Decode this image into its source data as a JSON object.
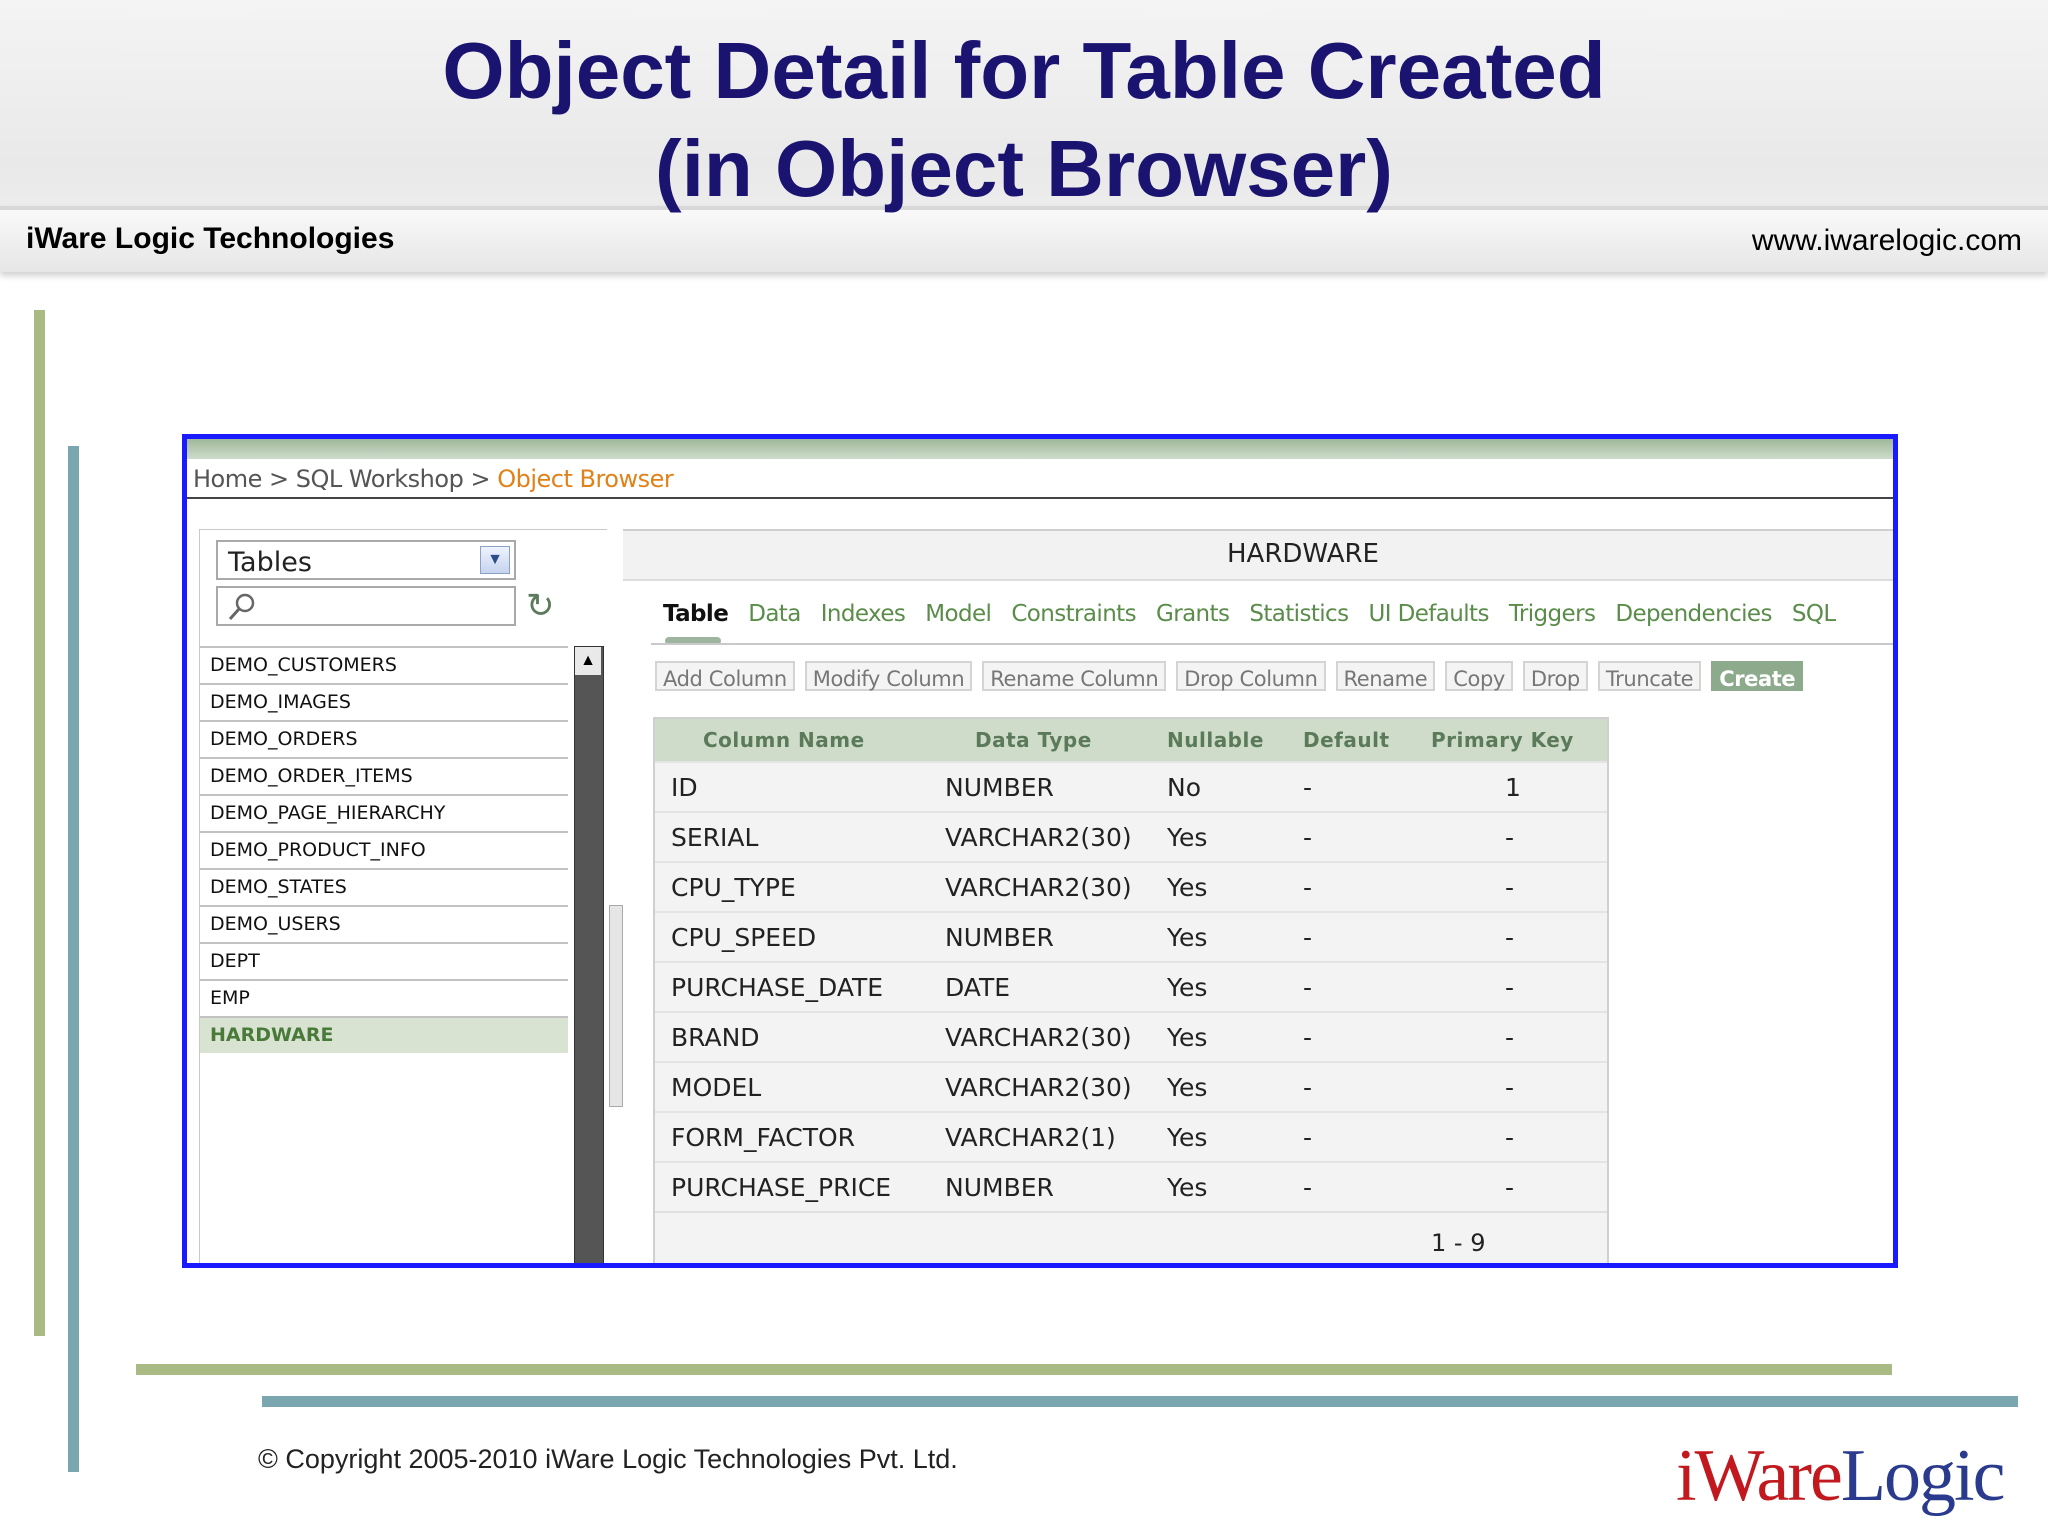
{
  "slide": {
    "title_line1": "Object Detail for Table Created",
    "title_line2": "(in Object Browser)",
    "company": "iWare Logic Technologies",
    "url": "www.iwarelogic.com",
    "copyright": "© Copyright 2005-2010 iWare Logic Technologies Pvt. Ltd.",
    "logo": {
      "part1": "iWare",
      "part2": "Logic"
    }
  },
  "breadcrumb": {
    "items": [
      "Home",
      "SQL Workshop"
    ],
    "separator": ">",
    "current": "Object Browser"
  },
  "object_list": {
    "type_select_value": "Tables",
    "search_value": "",
    "items": [
      "DEMO_CUSTOMERS",
      "DEMO_IMAGES",
      "DEMO_ORDERS",
      "DEMO_ORDER_ITEMS",
      "DEMO_PAGE_HIERARCHY",
      "DEMO_PRODUCT_INFO",
      "DEMO_STATES",
      "DEMO_USERS",
      "DEPT",
      "EMP",
      "HARDWARE"
    ],
    "selected": "HARDWARE"
  },
  "object_detail": {
    "title": "HARDWARE",
    "tabs": [
      "Table",
      "Data",
      "Indexes",
      "Model",
      "Constraints",
      "Grants",
      "Statistics",
      "UI Defaults",
      "Triggers",
      "Dependencies",
      "SQL"
    ],
    "active_tab": "Table",
    "actions": [
      "Add Column",
      "Modify Column",
      "Rename Column",
      "Drop Column",
      "Rename",
      "Copy",
      "Drop",
      "Truncate",
      "Create"
    ],
    "columns_header": [
      "Column Name",
      "Data Type",
      "Nullable",
      "Default",
      "Primary Key"
    ],
    "rows": [
      [
        "ID",
        "NUMBER",
        "No",
        "-",
        "1"
      ],
      [
        "SERIAL",
        "VARCHAR2(30)",
        "Yes",
        "-",
        "-"
      ],
      [
        "CPU_TYPE",
        "VARCHAR2(30)",
        "Yes",
        "-",
        "-"
      ],
      [
        "CPU_SPEED",
        "NUMBER",
        "Yes",
        "-",
        "-"
      ],
      [
        "PURCHASE_DATE",
        "DATE",
        "Yes",
        "-",
        "-"
      ],
      [
        "BRAND",
        "VARCHAR2(30)",
        "Yes",
        "-",
        "-"
      ],
      [
        "MODEL",
        "VARCHAR2(30)",
        "Yes",
        "-",
        "-"
      ],
      [
        "FORM_FACTOR",
        "VARCHAR2(1)",
        "Yes",
        "-",
        "-"
      ],
      [
        "PURCHASE_PRICE",
        "NUMBER",
        "Yes",
        "-",
        "-"
      ]
    ],
    "pagination": "1 - 9"
  },
  "colors": {
    "title": "#1a1470",
    "frame_border": "#1a1aff",
    "accent_green": "#a9bb82",
    "accent_teal": "#7aa6b0",
    "tab_green": "#5a8c4a",
    "breadcrumb_current": "#e0821a"
  }
}
